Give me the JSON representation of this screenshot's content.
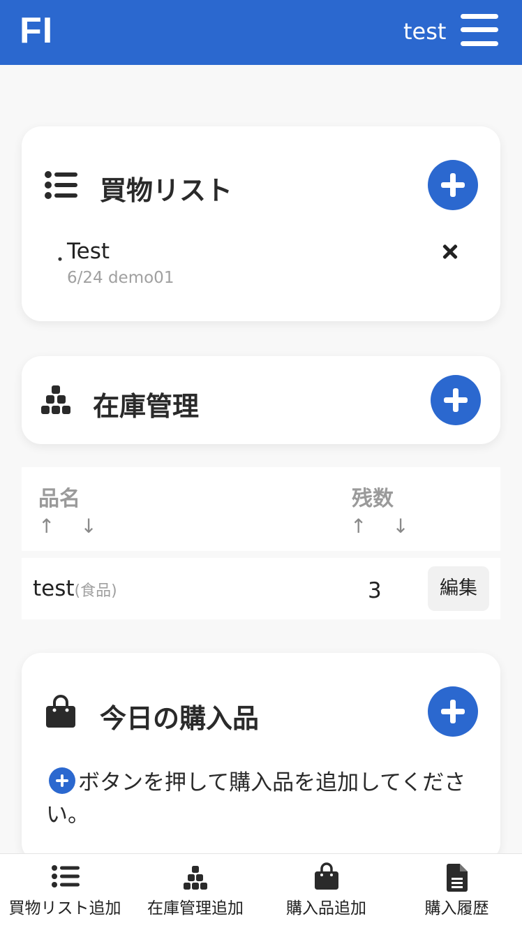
{
  "header": {
    "logo": "FI",
    "username": "test"
  },
  "shopping_list": {
    "title": "買物リスト",
    "items": [
      {
        "bullet": "・",
        "name": "Test",
        "meta": "6/24 demo01"
      }
    ]
  },
  "inventory": {
    "title": "在庫管理",
    "columns": [
      {
        "label": "品名",
        "sort": "↑ ↓"
      },
      {
        "label": "残数",
        "sort": "↑ ↓"
      }
    ],
    "rows": [
      {
        "name": "test",
        "category": "(食品)",
        "quantity": "3",
        "edit_label": "編集"
      }
    ]
  },
  "todays_purchases": {
    "title": "今日の購入品",
    "hint": "ボタンを押して購入品を追加してください。"
  },
  "bottom_nav": [
    {
      "label": "買物リスト追加",
      "icon": "list-icon"
    },
    {
      "label": "在庫管理追加",
      "icon": "cubes-icon"
    },
    {
      "label": "購入品追加",
      "icon": "bag-icon"
    },
    {
      "label": "購入履歴",
      "icon": "document-icon"
    }
  ]
}
